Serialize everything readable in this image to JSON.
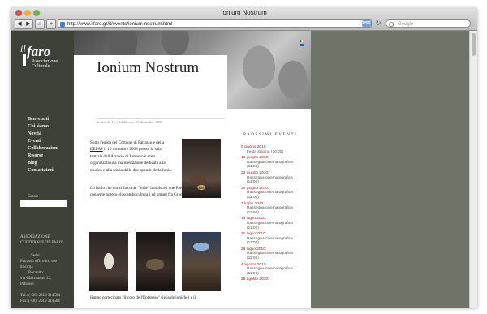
{
  "browser": {
    "window_title": "Ionium Nostrum",
    "url": "http://www.ilfaro.gr/it/events/ionium-nostrum.html",
    "search_placeholder": "Google",
    "back_glyph": "◀",
    "forward_glyph": "▶",
    "home_glyph": "⌂",
    "add_glyph": "+",
    "rss_label": "RSS",
    "reload_glyph": "↻"
  },
  "logo": {
    "il": "il",
    "faro": "faro",
    "line1": "Associazione",
    "line2": "Culturale"
  },
  "nav": [
    "Benvenuti",
    "Chi siamo",
    "Novità",
    "Eventi",
    "Collaborazioni",
    "Risorse",
    "Blog",
    "Contattateci"
  ],
  "search_label": "Cerca:",
  "sidebar_info": {
    "assoc_line1": "ASSOCIAZIONE",
    "assoc_line2": "CULTURALE \"IL FARO\"",
    "sede_label": "Sede:",
    "sede_line1": "Patrasso «Το σπίτι του",
    "sede_line2": "πολίτη»",
    "recapito_label": "Recapito:",
    "recapito_line1": "via Glavmadou 13,",
    "recapito_line2": "Patrasso",
    "tel": "Tel.: (+30) 2610 314564",
    "fax": "Fax: (+30) 2610 314564"
  },
  "article": {
    "title": "Ionium Nostrum",
    "byline": "Scritto da Lu | Pubblicato: 14 dicembre 2008",
    "p1_before": "Sotto l'egida del Comune di Patrasso e della ",
    "p1_link": "DEPAP",
    "p1_after": " il 10 dicembre 2008 presso la sala teatrale dell'Arsakio di Patrasso è stata organizzata una manifestazione dedicata alla musica e alla storia delle due sponde dello Ionio.",
    "p2": "Lo Ionio che ora ci fa come \"onde\" lambisce i due Paesi e ha consentito e consente tuttora gli scambi culturali ed umani fra Grecia ed Italia.",
    "p3": "Hanno partecipato \"il coro dell'Eptaneso\" (le isole ioniche) e il"
  },
  "events": {
    "heading": "PROSSIMI EVENTI",
    "items": [
      {
        "date": "9 giugno 2010:",
        "title": "Festa italiana (10:00)",
        "time": ""
      },
      {
        "date": "16 giugno 2010:",
        "title": "Rassegna cinematografica",
        "time": "(11:00)"
      },
      {
        "date": "23 giugno 2010:",
        "title": "Rassegna cinematografica",
        "time": "(11:00)"
      },
      {
        "date": "30 giugno 2010:",
        "title": "Rassegna cinematografica",
        "time": "(11:00)"
      },
      {
        "date": "7 luglio 2010:",
        "title": "Rassegna cinematografica",
        "time": "(11:00)"
      },
      {
        "date": "14 luglio 2010:",
        "title": "Rassegna cinematografica",
        "time": "(11:00)"
      },
      {
        "date": "21 luglio 2010:",
        "title": "Rassegna cinematografica",
        "time": "(11:00)"
      },
      {
        "date": "28 luglio 2010:",
        "title": "Rassegna cinematografica",
        "time": "(11:00)"
      },
      {
        "date": "4 agosto 2010:",
        "title": "Rassegna cinematografica",
        "time": "(11:00)"
      },
      {
        "date": "25 agosto 2010:",
        "title": "",
        "time": ""
      }
    ]
  },
  "colors": {
    "sidebar_bg": "#3d4138",
    "backdrop": "#6f7468",
    "event_date": "#a02020"
  }
}
